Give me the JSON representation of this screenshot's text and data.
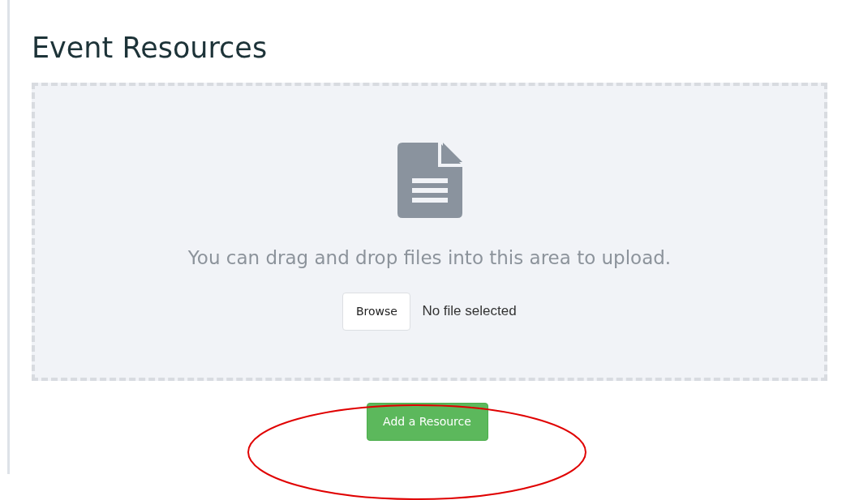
{
  "heading": "Event Resources",
  "dropzone": {
    "message": "You can drag and drop files into this area to upload.",
    "browse_button": "Browse",
    "file_status": "No file selected"
  },
  "add_button": "Add a Resource"
}
